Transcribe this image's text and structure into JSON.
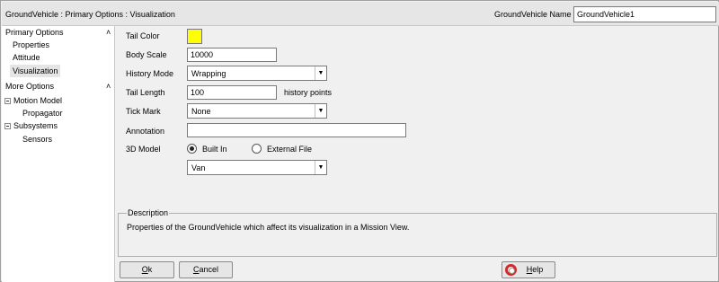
{
  "window": {
    "title": "GroundVehicle : Primary Options : Visualization",
    "name_label": "GroundVehicle Name",
    "name_value": "GroundVehicle1"
  },
  "sidebar": {
    "primary_options": {
      "label": "Primary Options",
      "collapse_icon": "double-chevron-up-icon",
      "items": [
        "Properties",
        "Attitude",
        "Visualization"
      ],
      "selected": "Visualization"
    },
    "more_options": {
      "label": "More Options",
      "collapse_icon": "double-chevron-up-icon",
      "groups": [
        {
          "label": "Motion Model",
          "children": [
            "Propagator"
          ]
        },
        {
          "label": "Subsystems",
          "children": [
            "Sensors"
          ]
        }
      ]
    }
  },
  "form": {
    "tail_color": {
      "label": "Tail Color",
      "color": "#ffff00"
    },
    "body_scale": {
      "label": "Body Scale",
      "value": "10000"
    },
    "history_mode": {
      "label": "History Mode",
      "value": "Wrapping"
    },
    "tail_length": {
      "label": "Tail Length",
      "value": "100",
      "suffix": "history points"
    },
    "tick_mark": {
      "label": "Tick Mark",
      "value": "None"
    },
    "annotation": {
      "label": "Annotation",
      "value": ""
    },
    "model_3d": {
      "label": "3D Model",
      "option_built_in": "Built In",
      "option_external": "External File",
      "selected": "Built In",
      "model_value": "Van"
    }
  },
  "description": {
    "title": "Description",
    "text": "Properties of the GroundVehicle which affect its visualization in a Mission View."
  },
  "buttons": {
    "ok": {
      "accel": "O",
      "rest": "k"
    },
    "cancel": {
      "accel": "C",
      "rest": "ancel"
    },
    "help": {
      "accel": "H",
      "rest": "elp",
      "icon": "lifebuoy-icon"
    }
  }
}
